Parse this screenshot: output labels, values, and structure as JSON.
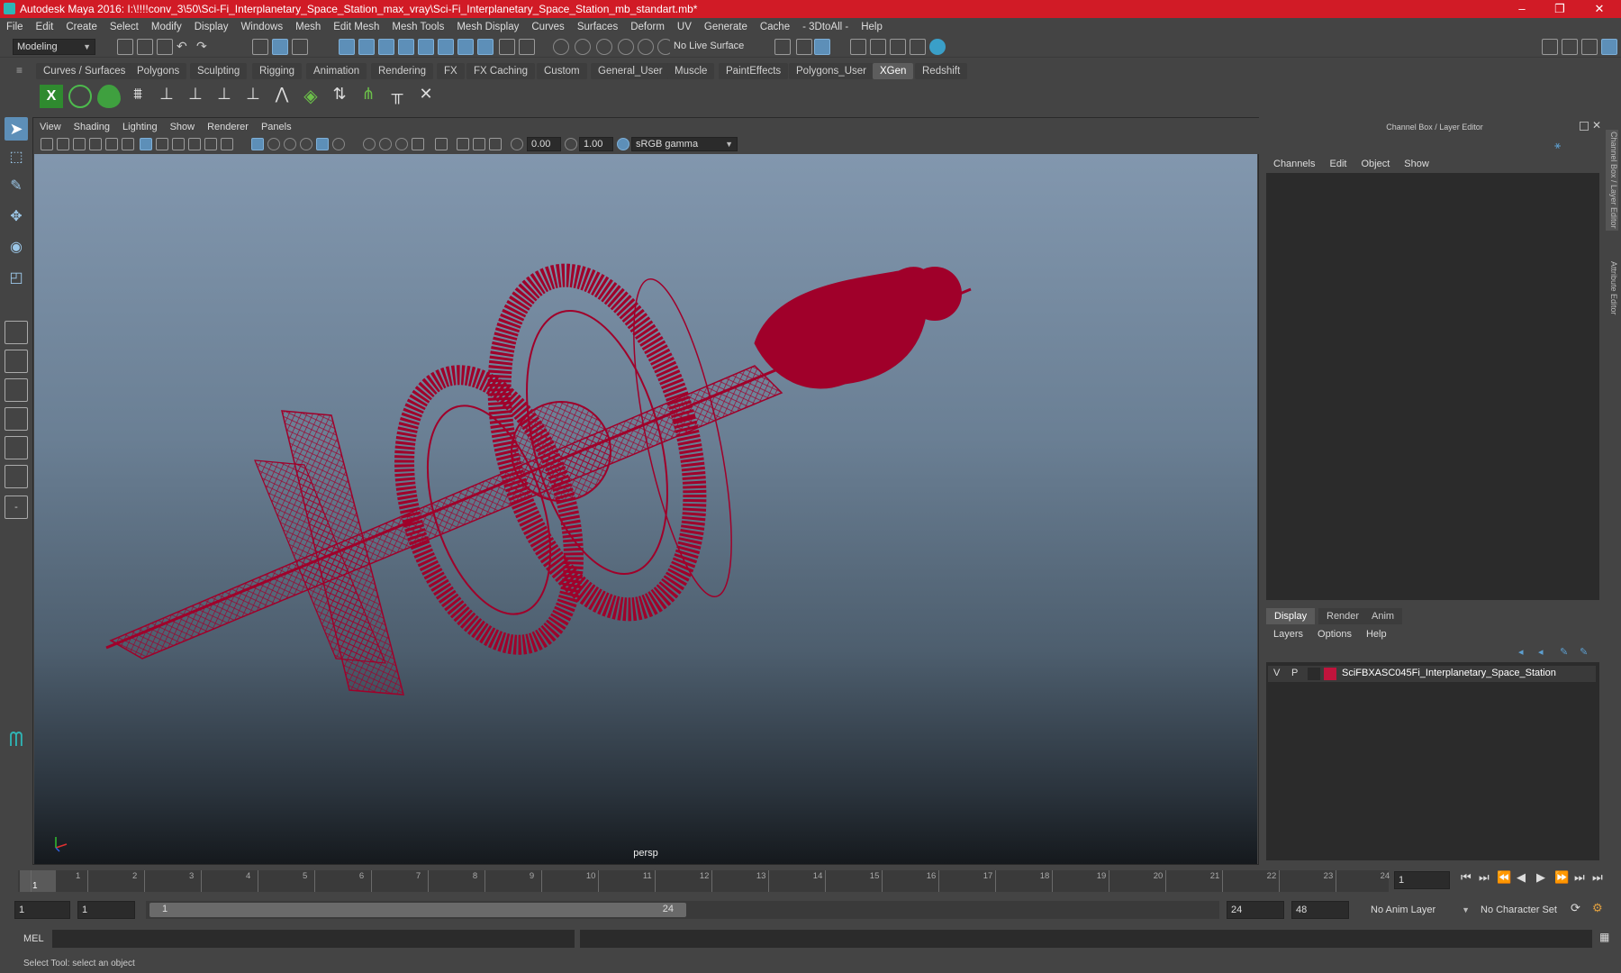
{
  "window": {
    "title": "Autodesk Maya 2016: I:\\!!!!conv_3\\50\\Sci-Fi_Interplanetary_Space_Station_max_vray\\Sci-Fi_Interplanetary_Space_Station_mb_standart.mb*",
    "minimize": "–",
    "restore": "❐",
    "close": "✕"
  },
  "menubar": [
    "File",
    "Edit",
    "Create",
    "Select",
    "Modify",
    "Display",
    "Windows",
    "Mesh",
    "Edit Mesh",
    "Mesh Tools",
    "Mesh Display",
    "Curves",
    "Surfaces",
    "Deform",
    "UV",
    "Generate",
    "Cache",
    "- 3DtoAll -",
    "Help"
  ],
  "statusline": {
    "mode": "Modeling",
    "live_surface": "No Live Surface"
  },
  "shelf_tabs": [
    "Curves / Surfaces",
    "Polygons",
    "Sculpting",
    "Rigging",
    "Animation",
    "Rendering",
    "FX",
    "FX Caching",
    "Custom",
    "General_User",
    "Muscle",
    "PaintEffects",
    "Polygons_User",
    "XGen",
    "Redshift"
  ],
  "shelf_active": "XGen",
  "viewport": {
    "menu": [
      "View",
      "Shading",
      "Lighting",
      "Show",
      "Renderer",
      "Panels"
    ],
    "exposure": "0.00",
    "gamma": "1.00",
    "color_space": "sRGB gamma",
    "camera_label": "persp",
    "wire_color": "#a0002a"
  },
  "channelbox": {
    "title": "Channel Box / Layer Editor",
    "menu": [
      "Channels",
      "Edit",
      "Object",
      "Show"
    ],
    "layer_tabs": [
      "Display",
      "Render",
      "Anim"
    ],
    "layer_menu": [
      "Layers",
      "Options",
      "Help"
    ],
    "layer": {
      "v": "V",
      "p": "P",
      "name": "SciFBXASC045Fi_Interplanetary_Space_Station",
      "color": "#c0143c"
    }
  },
  "side_tabs": [
    "Channel Box / Layer Editor",
    "Attribute Editor"
  ],
  "timeslider": {
    "ticks": [
      "1",
      "2",
      "3",
      "4",
      "5",
      "6",
      "7",
      "8",
      "9",
      "10",
      "11",
      "12",
      "13",
      "14",
      "15",
      "16",
      "17",
      "18",
      "19",
      "20",
      "21",
      "22",
      "23",
      "24"
    ],
    "current_marker": "1",
    "current_frame": "1"
  },
  "range": {
    "start": "1",
    "playback_start": "1",
    "range_start_label": "1",
    "range_end_label": "24",
    "playback_end": "24",
    "end": "48",
    "anim_layer": "No Anim Layer",
    "character_set": "No Character Set"
  },
  "cmdline": {
    "label": "MEL"
  },
  "helpline": {
    "text": "Select Tool: select an object"
  }
}
